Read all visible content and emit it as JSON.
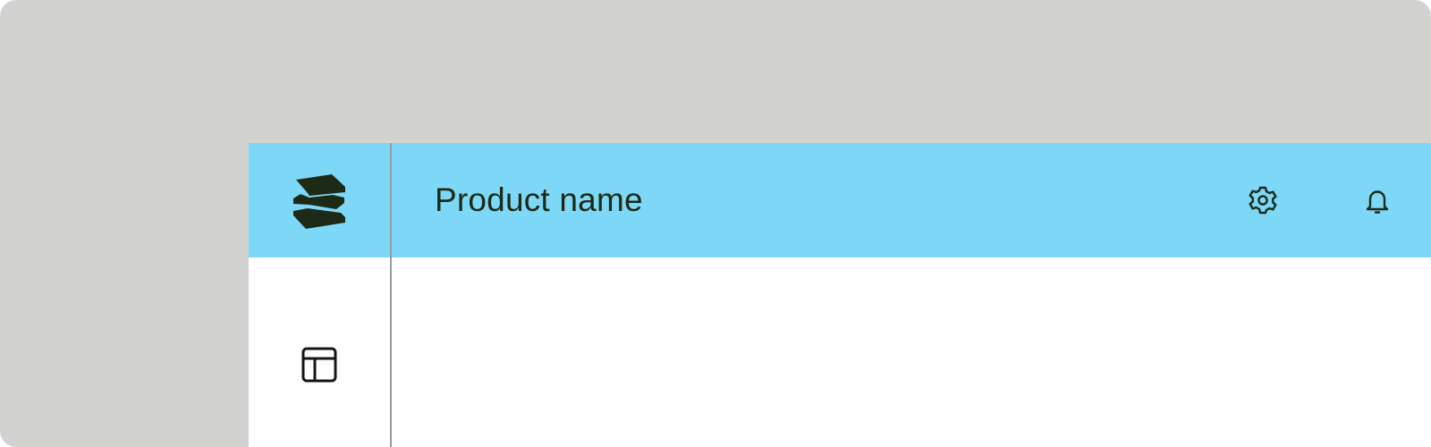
{
  "header": {
    "product_name": "Product name"
  },
  "icons": {
    "logo": "stacked-layers-logo",
    "settings": "gear-icon",
    "notifications": "bell-icon",
    "layout": "layout-panel-icon"
  },
  "colors": {
    "background": "#d2d3d1",
    "header": "#7dd8f8",
    "surface": "#ffffff",
    "icon": "#1d2a16"
  }
}
